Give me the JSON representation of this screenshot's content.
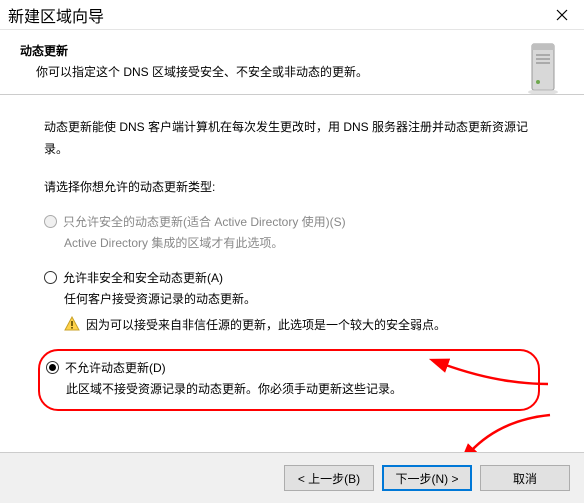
{
  "titlebar": {
    "title": "新建区域向导"
  },
  "header": {
    "title": "动态更新",
    "sub": "你可以指定这个 DNS 区域接受安全、不安全或非动态的更新。"
  },
  "content": {
    "desc": "动态更新能使 DNS 客户端计算机在每次发生更改时，用 DNS 服务器注册并动态更新资源记录。",
    "prompt": "请选择你想允许的动态更新类型:"
  },
  "opt1": {
    "label": "只允许安全的动态更新(适合 Active Directory 使用)(S)",
    "sub": "Active Directory 集成的区域才有此选项。"
  },
  "opt2": {
    "label": "允许非安全和安全动态更新(A)",
    "sub": "任何客户接受资源记录的动态更新。",
    "warn": "因为可以接受来自非信任源的更新，此选项是一个较大的安全弱点。"
  },
  "opt3": {
    "label": "不允许动态更新(D)",
    "sub": "此区域不接受资源记录的动态更新。你必须手动更新这些记录。"
  },
  "footer": {
    "back": "< 上一步(B)",
    "next": "下一步(N) >",
    "cancel": "取消"
  }
}
